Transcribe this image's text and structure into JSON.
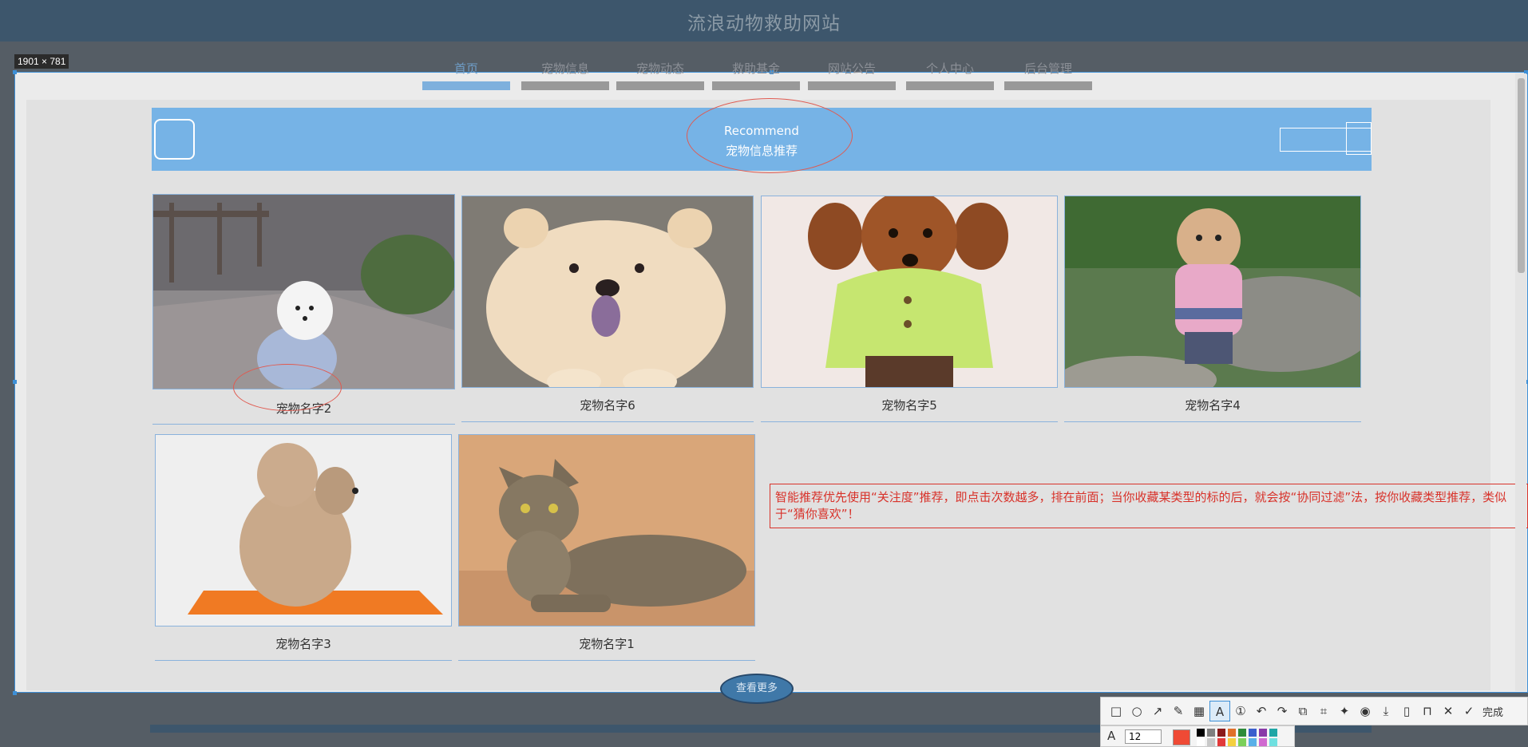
{
  "site": {
    "title": "流浪动物救助网站"
  },
  "capture": {
    "size_label": "1901 × 781"
  },
  "nav": {
    "items": [
      {
        "label": "首页",
        "active": true
      },
      {
        "label": "宠物信息",
        "active": false
      },
      {
        "label": "宠物动态",
        "active": false
      },
      {
        "label": "救助基金",
        "active": false
      },
      {
        "label": "网站公告",
        "active": false
      },
      {
        "label": "个人中心",
        "active": false
      },
      {
        "label": "后台管理",
        "active": false
      }
    ]
  },
  "banner": {
    "title_en": "Recommend",
    "title_cn": "宠物信息推荐"
  },
  "pets": [
    {
      "name": "宠物名字2",
      "image": "white-bichon-dog-photo"
    },
    {
      "name": "宠物名字6",
      "image": "cream-chow-chow-puppy-photo"
    },
    {
      "name": "宠物名字5",
      "image": "red-poodle-green-coat-photo"
    },
    {
      "name": "宠物名字4",
      "image": "apricot-poodle-pink-sweater-photo"
    },
    {
      "name": "宠物名字3",
      "image": "poodle-orange-cushion-photo"
    },
    {
      "name": "宠物名字1",
      "image": "tabby-cat-photo"
    }
  ],
  "annotation": {
    "text": "智能推荐优先使用“关注度”推荐，即点击次数越多，排在前面；当你收藏某类型的标的后，就会按“协同过滤”法，按你收藏类型推荐，类似于“猜你喜欢”！"
  },
  "more_button": {
    "label": "查看更多"
  },
  "toolbar": {
    "tools": [
      "rectangle-tool",
      "ellipse-tool",
      "arrow-tool",
      "pen-tool",
      "mosaic-tool",
      "text-tool",
      "number-tool",
      "undo-tool",
      "redo-tool",
      "copy-tool",
      "ocr-tool",
      "pin-tool",
      "record-tool",
      "download-tool",
      "save-tool",
      "bookmark-tool",
      "cancel-tool"
    ],
    "done_label": "完成",
    "font_size": "12",
    "current_color": "#ef4a35"
  }
}
